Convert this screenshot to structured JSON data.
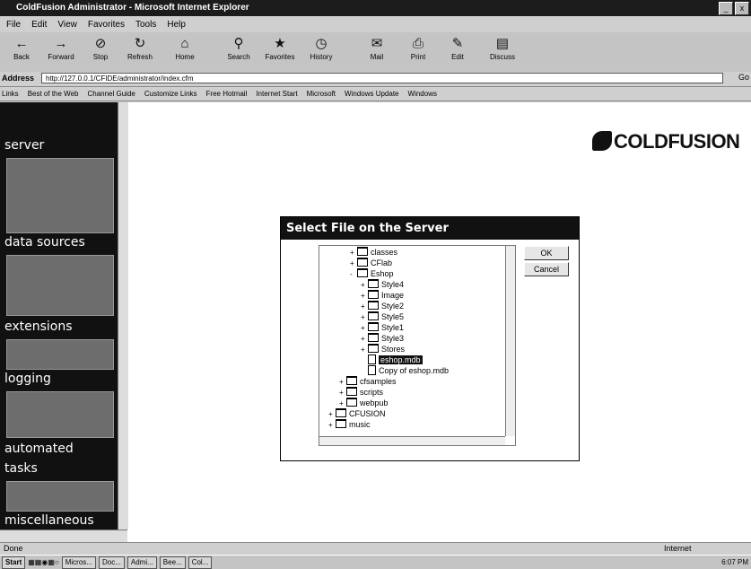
{
  "window": {
    "title": "ColdFusion Administrator - Microsoft Internet Explorer",
    "controls": [
      "_",
      "x"
    ]
  },
  "menu": [
    "File",
    "Edit",
    "View",
    "Favorites",
    "Tools",
    "Help"
  ],
  "toolbar": [
    {
      "label": "Back",
      "icon": "back-arrow-icon"
    },
    {
      "label": "Forward",
      "icon": "forward-arrow-icon"
    },
    {
      "label": "Stop",
      "icon": "stop-icon"
    },
    {
      "label": "Refresh",
      "icon": "refresh-icon"
    },
    {
      "label": "Home",
      "icon": "home-icon"
    },
    {
      "label": "Search",
      "icon": "search-icon"
    },
    {
      "label": "Favorites",
      "icon": "favorites-icon"
    },
    {
      "label": "History",
      "icon": "history-icon"
    },
    {
      "label": "Mail",
      "icon": "mail-icon"
    },
    {
      "label": "Print",
      "icon": "print-icon"
    },
    {
      "label": "Edit",
      "icon": "edit-icon"
    },
    {
      "label": "Discuss",
      "icon": "discuss-icon"
    }
  ],
  "address": {
    "label": "Address",
    "url": "http://127.0.0.1/CFIDE/administrator/index.cfm",
    "go": "Go"
  },
  "links": {
    "label": "Links",
    "items": [
      "Best of the Web",
      "Channel Guide",
      "Customize Links",
      "Free Hotmail",
      "Internet Start",
      "Microsoft",
      "Windows Update",
      "Windows"
    ]
  },
  "sidebar": {
    "sections": [
      "server",
      "data sources",
      "extensions",
      "logging",
      "automated",
      "tasks",
      "miscellaneous"
    ]
  },
  "logo": {
    "text": "COLDFUSION"
  },
  "dialog": {
    "title": "Select File on the Server",
    "ok_label": "OK",
    "cancel_label": "Cancel",
    "tree": [
      {
        "label": "classes",
        "type": "folder",
        "level": 2,
        "expander": "+"
      },
      {
        "label": "CFlab",
        "type": "folder",
        "level": 2,
        "expander": "+"
      },
      {
        "label": "Eshop",
        "type": "folder",
        "level": 2,
        "expander": "-"
      },
      {
        "label": "Style4",
        "type": "folder",
        "level": 3,
        "expander": "+"
      },
      {
        "label": "Image",
        "type": "folder",
        "level": 3,
        "expander": "+"
      },
      {
        "label": "Style2",
        "type": "folder",
        "level": 3,
        "expander": "+"
      },
      {
        "label": "Style5",
        "type": "folder",
        "level": 3,
        "expander": "+"
      },
      {
        "label": "Style1",
        "type": "folder",
        "level": 3,
        "expander": "+"
      },
      {
        "label": "Style3",
        "type": "folder",
        "level": 3,
        "expander": "+"
      },
      {
        "label": "Stores",
        "type": "folder",
        "level": 3,
        "expander": "+"
      },
      {
        "label": "eshop.mdb",
        "type": "file",
        "level": 3,
        "expander": "",
        "selected": true
      },
      {
        "label": "Copy of eshop.mdb",
        "type": "file",
        "level": 3,
        "expander": ""
      },
      {
        "label": "cfsamples",
        "type": "folder",
        "level": 1,
        "expander": "+"
      },
      {
        "label": "scripts",
        "type": "folder",
        "level": 1,
        "expander": "+"
      },
      {
        "label": "webpub",
        "type": "folder",
        "level": 1,
        "expander": "+"
      },
      {
        "label": "CFUSION",
        "type": "folder",
        "level": 0,
        "expander": "+"
      },
      {
        "label": "music",
        "type": "folder",
        "level": 0,
        "expander": "+"
      }
    ]
  },
  "status": {
    "left": "Done",
    "zone": "Internet"
  },
  "taskbar": {
    "start": "Start",
    "tasks": [
      "Micros...",
      "Doc...",
      "Admi...",
      "Bee...",
      "Col..."
    ],
    "clock": "6:07 PM"
  },
  "colors": {
    "sidebar_bg": "#111111",
    "highlight": "#111111"
  }
}
